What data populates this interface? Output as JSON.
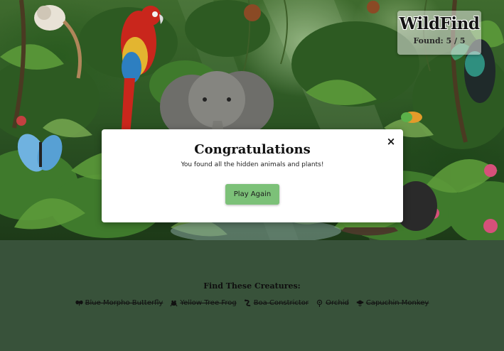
{
  "game": {
    "title": "WildFind",
    "found_label": "Found: 5 / 5"
  },
  "modal": {
    "heading": "Congratulations",
    "message": "You found all the hidden animals and plants!",
    "play_again_label": "Play Again",
    "close_glyph": "×"
  },
  "find_list": {
    "heading": "Find These Creatures:",
    "items": [
      {
        "label": "Blue Morpho Butterfly",
        "icon": "butterfly-icon",
        "found": true
      },
      {
        "label": "Yellow Tree Frog",
        "icon": "frog-icon",
        "found": true
      },
      {
        "label": "Boa Constrictor",
        "icon": "snake-icon",
        "found": true
      },
      {
        "label": "Orchid",
        "icon": "flower-icon",
        "found": true
      },
      {
        "label": "Capuchin Monkey",
        "icon": "monkey-icon",
        "found": true
      }
    ]
  },
  "colors": {
    "background": "#38523a",
    "button": "#7cc178"
  }
}
